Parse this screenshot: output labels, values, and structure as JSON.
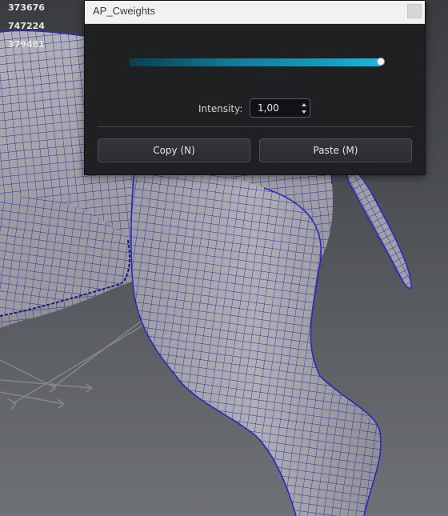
{
  "viewport": {
    "stats": [
      "373676",
      "747224",
      "379481"
    ]
  },
  "dialog": {
    "title": "AP_Cweights",
    "slider": {
      "value_fraction": 1.0
    },
    "intensity": {
      "label": "Intensity:",
      "value": "1,00"
    },
    "buttons": {
      "copy": "Copy (N)",
      "paste": "Paste (M)"
    }
  },
  "colors": {
    "accent": "#19b8e0",
    "wireframe": "#2a2ab8",
    "mesh_fill": "#a3a3a7"
  },
  "icons": {
    "close": "close-icon",
    "spin_up": "chevron-up-icon",
    "spin_down": "chevron-down-icon"
  }
}
